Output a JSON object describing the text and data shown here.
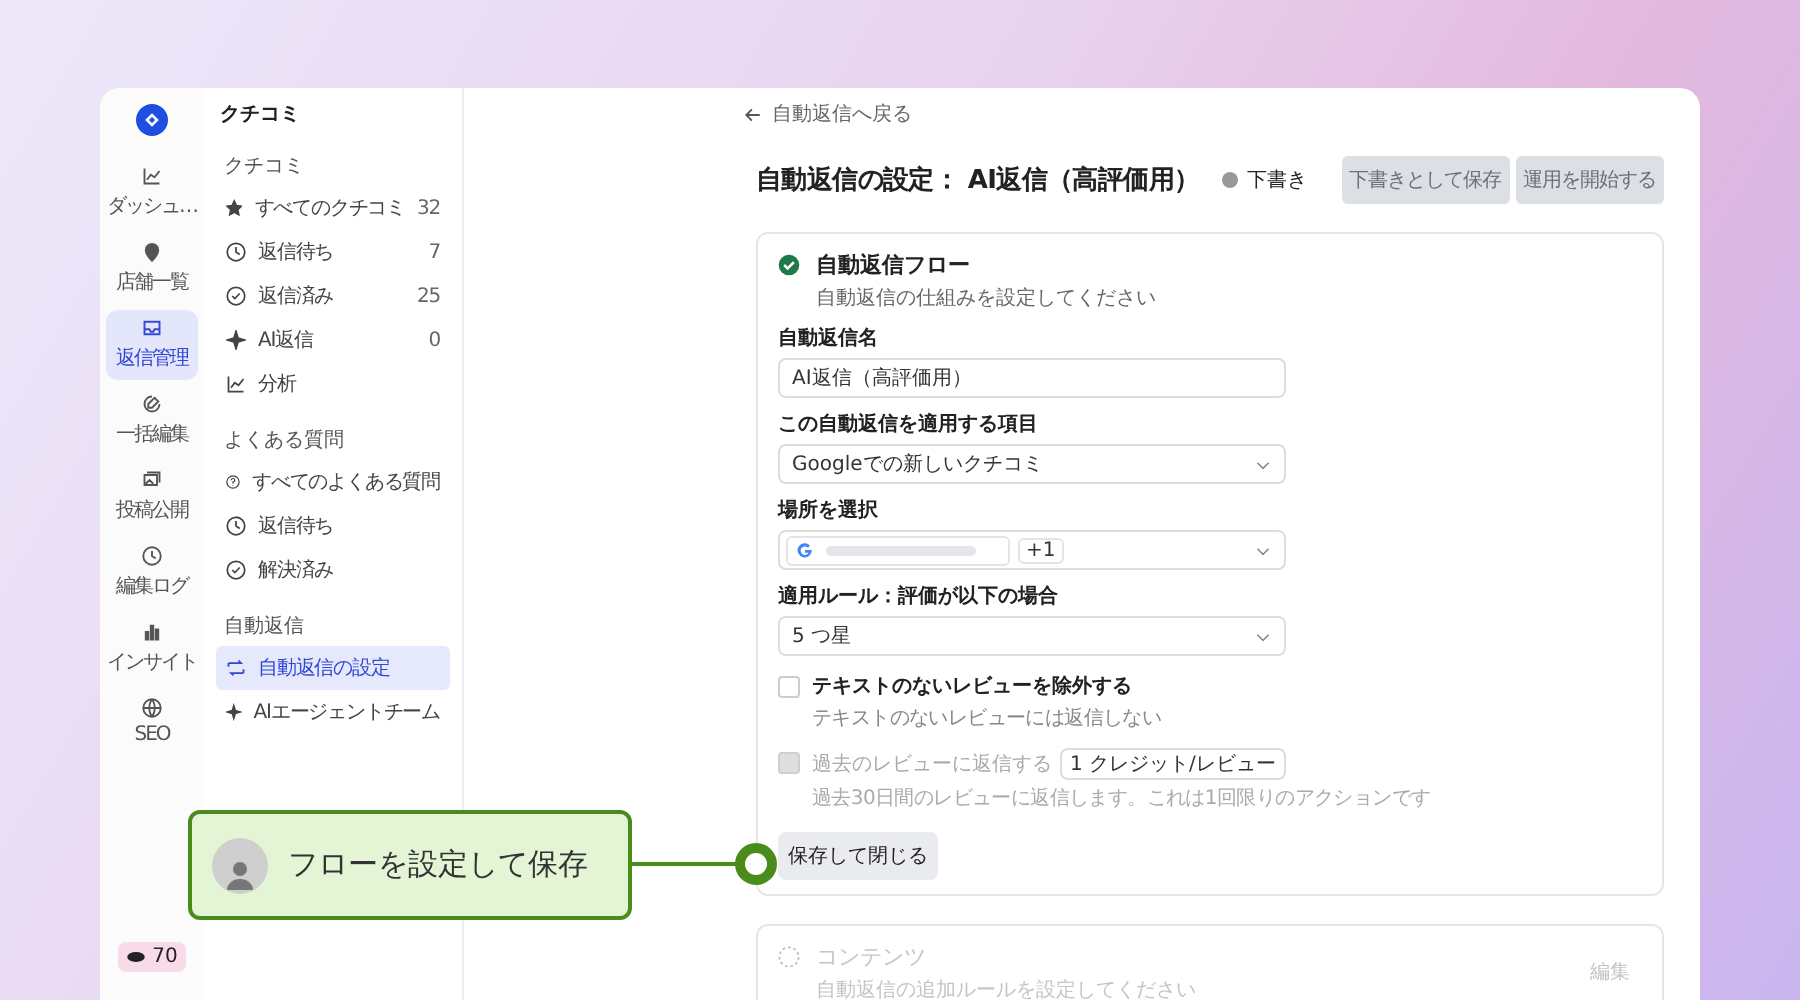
{
  "rail": {
    "items": [
      {
        "kind": "chart",
        "label": "ダッシュ…",
        "selected": false
      },
      {
        "kind": "pin",
        "label": "店舗一覧",
        "selected": false
      },
      {
        "kind": "inbox",
        "label": "返信管理",
        "selected": true
      },
      {
        "kind": "edit",
        "label": "一括編集",
        "selected": false
      },
      {
        "kind": "photo",
        "label": "投稿公開",
        "selected": false
      },
      {
        "kind": "clock",
        "label": "編集ログ",
        "selected": false
      },
      {
        "kind": "bars",
        "label": "インサイト",
        "selected": false
      },
      {
        "kind": "globe",
        "label": "SEO",
        "selected": false
      }
    ],
    "credits": "70"
  },
  "sidebar": {
    "title": "クチコミ",
    "sections": [
      {
        "heading": "クチコミ",
        "items": [
          {
            "kind": "star",
            "label": "すべてのクチコミ",
            "count": "32",
            "selected": false
          },
          {
            "kind": "clock",
            "label": "返信待ち",
            "count": "7",
            "selected": false
          },
          {
            "kind": "check",
            "label": "返信済み",
            "count": "25",
            "selected": false
          },
          {
            "kind": "sparkle",
            "label": "AI返信",
            "count": "0",
            "selected": false
          },
          {
            "kind": "chart",
            "label": "分析",
            "selected": false
          }
        ]
      },
      {
        "heading": "よくある質問",
        "items": [
          {
            "kind": "question",
            "label": "すべてのよくある質問",
            "selected": false
          },
          {
            "kind": "clock",
            "label": "返信待ち",
            "selected": false
          },
          {
            "kind": "check",
            "label": "解決済み",
            "selected": false
          }
        ]
      },
      {
        "heading": "自動返信",
        "items": [
          {
            "kind": "flow",
            "label": "自動返信の設定",
            "selected": true
          },
          {
            "kind": "sparkle",
            "label": "AIエージェントチーム",
            "selected": false
          }
        ]
      }
    ]
  },
  "back_link": "自動返信へ戻る",
  "title": "自動返信の設定： AI返信（高評価用）",
  "status": "下書き",
  "buttons": [
    {
      "label": "下書きとして保存",
      "disabled": true
    },
    {
      "label": "運用を開始する",
      "disabled": true
    }
  ],
  "cards": [
    {
      "title": "自動返信フロー",
      "subtitle": "自動返信の仕組みを設定してください",
      "done": true,
      "disabled": false,
      "fields": [
        {
          "kind": "text",
          "label": "自動返信名",
          "value": "AI返信（高評価用）"
        },
        {
          "kind": "select",
          "label": "この自動返信を適用する項目",
          "value": "Googleでの新しいクチコミ"
        },
        {
          "kind": "locations",
          "label": "場所を選択",
          "more": "+1"
        },
        {
          "kind": "select",
          "label": "適用ルール：評価が以下の場合",
          "value": "5 つ星"
        }
      ],
      "options": [
        {
          "label": "テキストのないレビューを除外する",
          "hint": "テキストのないレビューには返信しない",
          "checked": false,
          "disabled": false
        },
        {
          "label": "過去のレビューに返信する",
          "badge": "1 クレジット/レビュー",
          "hint": "過去30日間のレビューに返信します。これは1回限りのアクションです",
          "checked": false,
          "disabled": true
        }
      ],
      "save": "保存して閉じる"
    },
    {
      "title": "コンテンツ",
      "subtitle": "自動返信の追加ルールを設定してください",
      "done": false,
      "disabled": true,
      "action": "編集"
    }
  ],
  "callout": {
    "text": "フローを設定して保存"
  }
}
